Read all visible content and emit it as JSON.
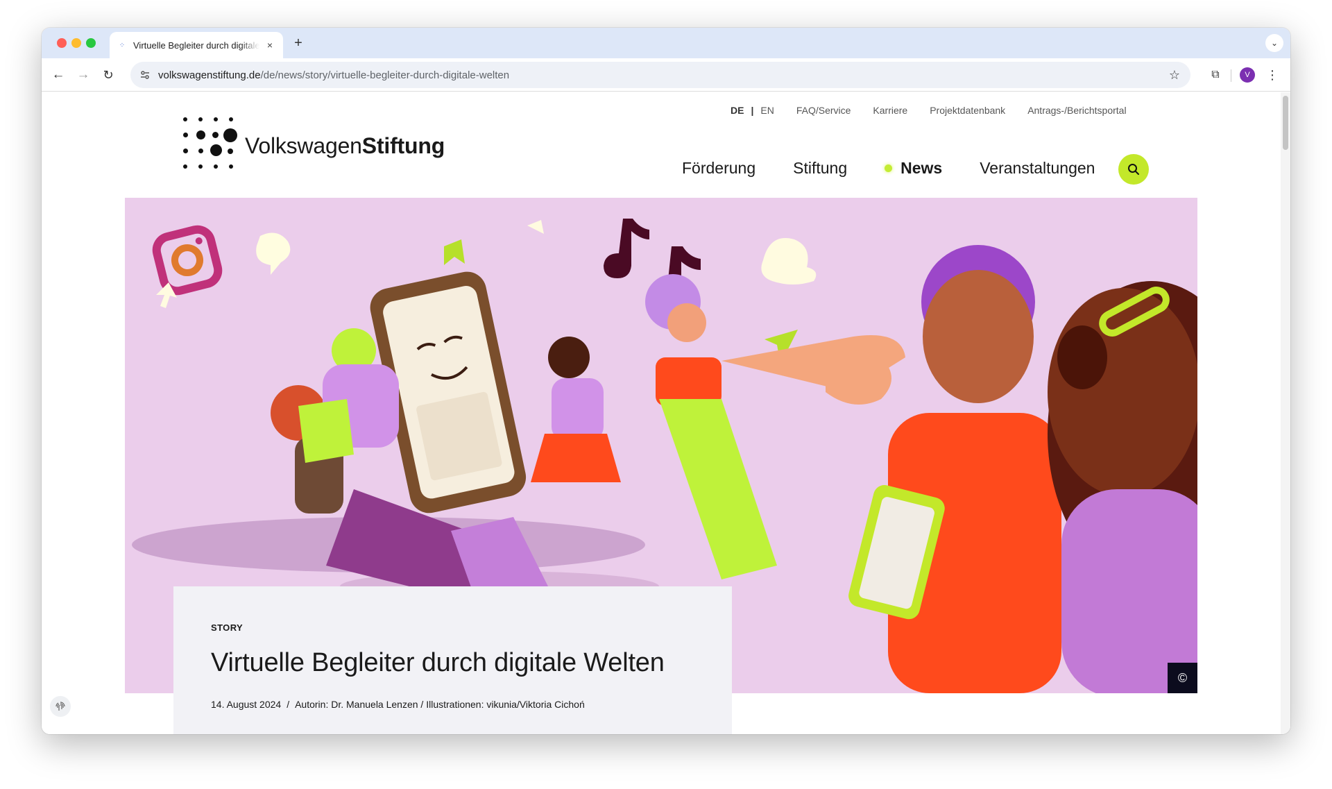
{
  "browser": {
    "tab": {
      "title": "Virtuelle Begleiter durch digitale Welten",
      "close": "×"
    },
    "new_tab": "+",
    "tab_list": "⌄",
    "nav": {
      "back": "←",
      "forward": "→",
      "reload": "↻"
    },
    "address": {
      "domain": "volkswagenstiftung.de",
      "path": "/de/news/story/virtuelle-begleiter-durch-digitale-welten"
    },
    "bookmark": "☆",
    "extensions": "⧉",
    "profile_initial": "V",
    "menu": "⋮"
  },
  "site": {
    "logo": {
      "part1": "Volkswagen",
      "part2": "Stiftung"
    },
    "meta_nav": {
      "lang_de": "DE",
      "lang_sep": "|",
      "lang_en": "EN",
      "items": [
        "FAQ/Service",
        "Karriere",
        "Projektdatenbank",
        "Antrags-/Berichtsportal"
      ]
    },
    "main_nav": {
      "items": [
        "Förderung",
        "Stiftung",
        "News",
        "Veranstaltungen"
      ],
      "active": "News"
    },
    "colors": {
      "accent": "#c3e82a",
      "hero_bg": "#ebcdeb"
    }
  },
  "hero": {
    "copyright": "©"
  },
  "article": {
    "kicker": "STORY",
    "title": "Virtuelle Begleiter durch digitale Welten",
    "date": "14. August 2024",
    "separator": "/",
    "credits": "Autorin: Dr. Manuela Lenzen / Illustrationen: vikunia/Viktoria Cichoń"
  }
}
